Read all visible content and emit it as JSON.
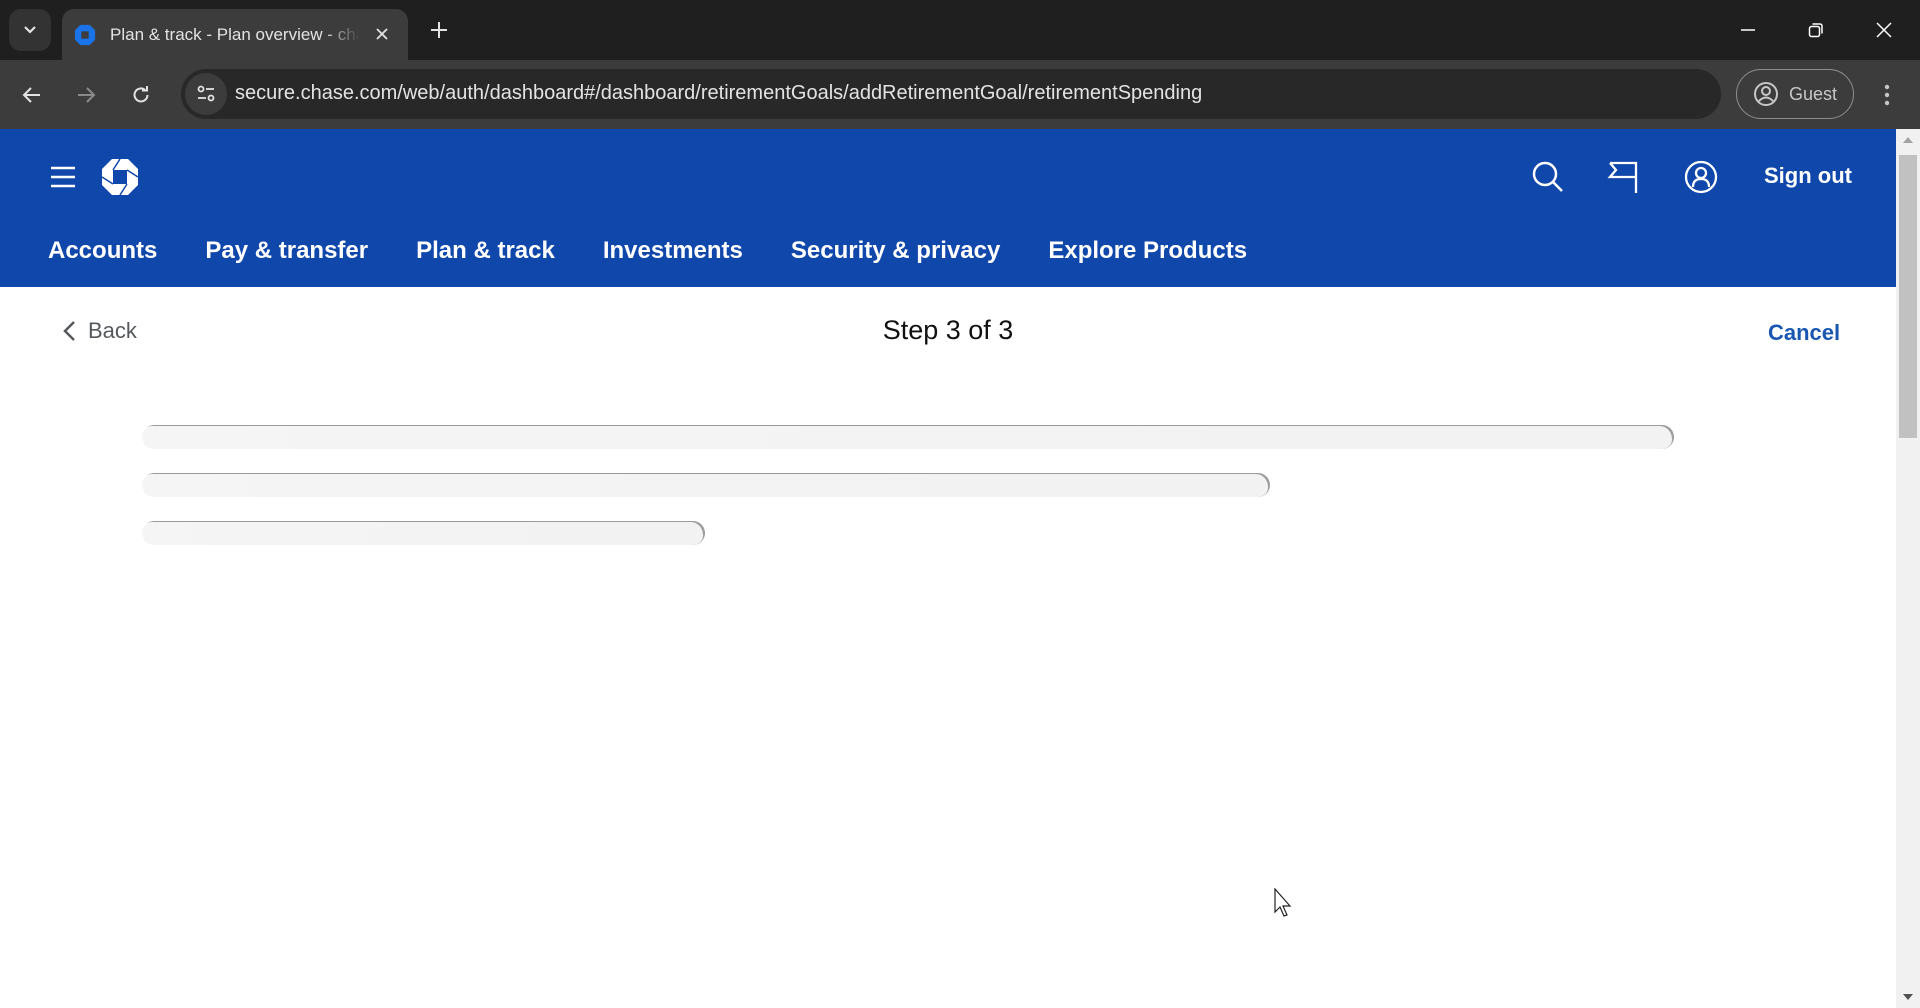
{
  "browser": {
    "tab": {
      "title": "Plan & track - Plan overview - chase.com"
    },
    "url": "secure.chase.com/web/auth/dashboard#/dashboard/retirementGoals/addRetirementGoal/retirementSpending",
    "profile_label": "Guest"
  },
  "header": {
    "sign_out_label": "Sign out",
    "nav": [
      {
        "label": "Accounts"
      },
      {
        "label": "Pay & transfer"
      },
      {
        "label": "Plan & track"
      },
      {
        "label": "Investments"
      },
      {
        "label": "Security & privacy"
      },
      {
        "label": "Explore Products"
      }
    ],
    "brand_color": "#1047aa"
  },
  "wizard": {
    "back_label": "Back",
    "step_label": "Step 3 of 3",
    "cancel_label": "Cancel"
  },
  "content": {
    "state": "loading",
    "skeleton_lines": 3
  }
}
